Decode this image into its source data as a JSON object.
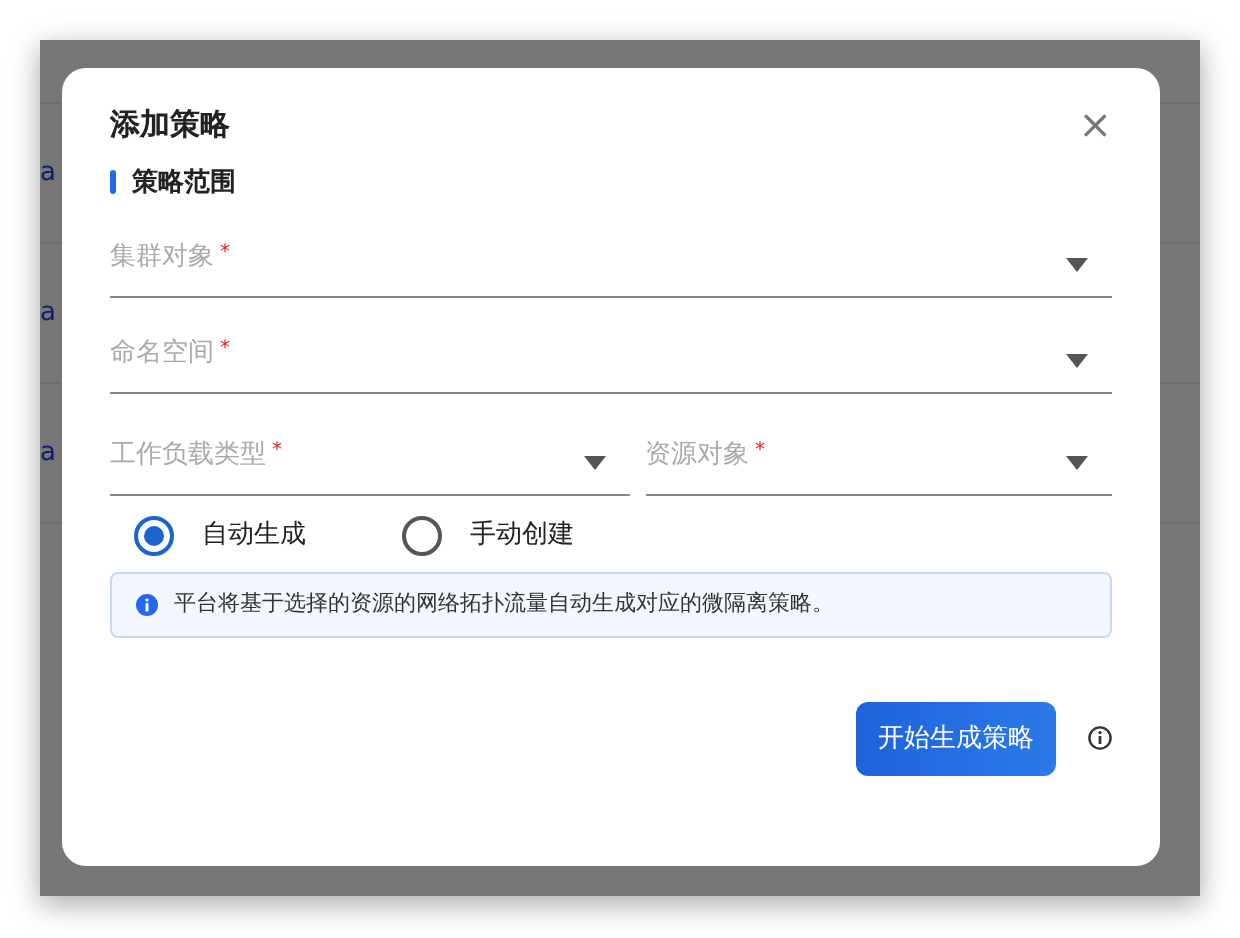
{
  "background": {
    "rows": [
      {
        "text": "a"
      },
      {
        "text": "a"
      },
      {
        "text": "a"
      }
    ]
  },
  "dialog": {
    "title": "添加策略",
    "close": "×",
    "section": "策略范围",
    "fields": [
      {
        "kind": "full",
        "label": "集群对象",
        "required_mark": "*"
      },
      {
        "kind": "full",
        "label": "命名空间",
        "required_mark": "*"
      },
      {
        "kind": "half",
        "label": "工作负载类型",
        "required_mark": "*"
      },
      {
        "kind": "half",
        "label": "资源对象",
        "required_mark": "*"
      }
    ],
    "radios": [
      {
        "label": "自动生成",
        "selected": true
      },
      {
        "label": "手动创建",
        "selected": false
      }
    ],
    "notice": "平台将基于选择的资源的网络拓扑流量自动生成对应的微隔离策略。",
    "submit": "开始生成策略"
  }
}
